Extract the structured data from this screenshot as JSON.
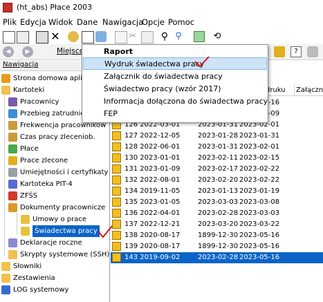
{
  "window": {
    "title": "(ht_abs) Płace 2003"
  },
  "menu": [
    "Plik",
    "Edycja",
    "Widok",
    "Dane",
    "Nawigacja",
    "Opcje",
    "Pomoc"
  ],
  "toolbar2": {
    "back_label": "◀",
    "forward_label": "▶",
    "location_label": "Miejsce"
  },
  "nav_header": "Nawigacja",
  "tree": [
    {
      "label": "Strona domowa aplikacji",
      "icon": "home-icon",
      "color": "#e89b1a",
      "level": 0
    },
    {
      "label": "Kartoteki",
      "icon": "folder-icon",
      "color": "#f2c14e",
      "level": 0
    },
    {
      "label": "Pracownicy",
      "icon": "people-icon",
      "color": "#7a5aa8",
      "level": 1
    },
    {
      "label": "Przebieg zatrudnienia",
      "icon": "chart-icon",
      "color": "#3a8fd8",
      "level": 1
    },
    {
      "label": "Frekwencja pracowników",
      "icon": "attendance-icon",
      "color": "#c99a3a",
      "level": 1
    },
    {
      "label": "Czas pracy zleceniob.",
      "icon": "clock-icon",
      "color": "#c99a3a",
      "level": 1
    },
    {
      "label": "Płace",
      "icon": "money-icon",
      "color": "#4aa84a",
      "level": 1
    },
    {
      "label": "Prace zlecone",
      "icon": "contract-icon",
      "color": "#e0b020",
      "level": 1
    },
    {
      "label": "Umiejętności i certyfikaty",
      "icon": "certificate-icon",
      "color": "#9aa0a8",
      "level": 1
    },
    {
      "label": "Kartoteka PIT-4",
      "icon": "pit4-icon",
      "color": "#5a6ad0",
      "level": 1
    },
    {
      "label": "ZFŚS",
      "icon": "zfss-icon",
      "color": "#d23a2a",
      "level": 1
    },
    {
      "label": "Dokumenty pracownicze",
      "icon": "folder-open-icon",
      "color": "#d89a2a",
      "level": 1
    },
    {
      "label": "Umowy o prace",
      "icon": "document-icon",
      "color": "#e8c040",
      "level": 2
    },
    {
      "label": "Świadectwa pracy",
      "icon": "document-icon",
      "color": "#e8c040",
      "level": 2,
      "selected": true
    },
    {
      "label": "Deklaracje roczne",
      "icon": "declaration-icon",
      "color": "#8a8ad0",
      "level": 1
    },
    {
      "label": "Skrypty systemowe (SSH)",
      "icon": "folder-icon",
      "color": "#f2c14e",
      "level": 1
    },
    {
      "label": "Słowniki",
      "icon": "folder-icon",
      "color": "#f2c14e",
      "level": 0
    },
    {
      "label": "Zestawienia",
      "icon": "folder-icon",
      "color": "#f2c14e",
      "level": 0
    },
    {
      "label": "LOG systemowy",
      "icon": "log-icon",
      "color": "#3a6ad0",
      "level": 0
    }
  ],
  "grid": {
    "columns": [
      "",
      "druku",
      "Załącznik"
    ],
    "rows": [
      [
        "",
        "",
        "2023-01-16"
      ],
      [
        "",
        "",
        "2023-01-09"
      ],
      [
        "126 2022-03-01",
        "2023-01-31",
        "2023-02-01"
      ],
      [
        "127 2022-12-05",
        "2023-01-28",
        "2023-01-31"
      ],
      [
        "128 2022-06-01",
        "2023-01-31",
        "2023-02-01"
      ],
      [
        "130 2023-01-01",
        "2023-02-11",
        "2023-02-15"
      ],
      [
        "131 2023-01-09",
        "2023-02-17",
        "2023-02-22"
      ],
      [
        "132 2022-08-01",
        "2023-02-20",
        "2023-02-22"
      ],
      [
        "134 2019-11-05",
        "2023-01-13",
        "2023-01-19"
      ],
      [
        "135 2023-01-05",
        "2023-03-03",
        "2023-03-08"
      ],
      [
        "136 2022-04-01",
        "2023-02-28",
        "2023-03-03"
      ],
      [
        "137 2022-12-21",
        "2023-03-20",
        "2023-03-22"
      ],
      [
        "138 2020-08-17",
        "1899-12-30",
        "2023-05-16"
      ],
      [
        "139 2020-08-17",
        "1899-12-30",
        "2023-05-16"
      ],
      [
        "143 2019-09-02",
        "2023-02-28",
        "2023-05-16"
      ]
    ],
    "selected_row": 14
  },
  "dropdown": {
    "items": [
      "Raport",
      "Wydruk świadectwa pracy",
      "Załącznik do świadectwa pracy",
      "Świadectwo pracy (wzór 2017)",
      "Informacja dołączona do świadectwa pracy",
      "FEP"
    ],
    "highlighted": 1
  },
  "colors": {
    "selection": "#0a64c8",
    "highlight": "#cde3f7",
    "checkmark": "#e01010"
  }
}
